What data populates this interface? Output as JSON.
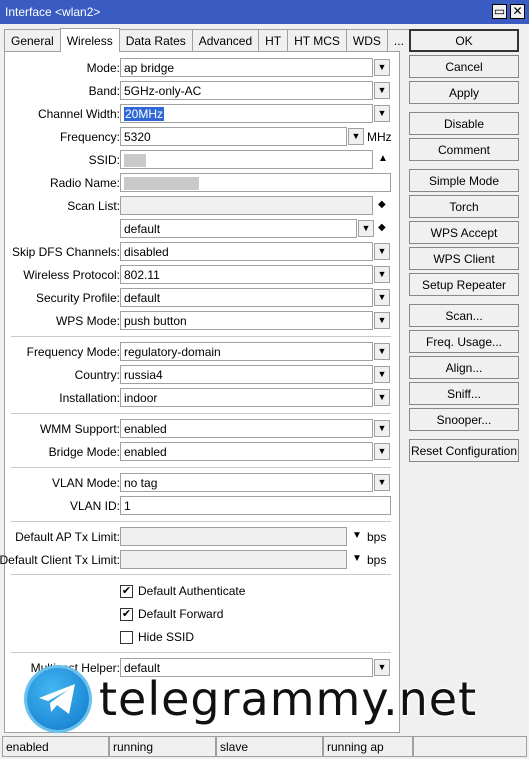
{
  "window": {
    "title": "Interface <wlan2>",
    "restore_glyph": "▭",
    "close_glyph": "✕"
  },
  "tabs": [
    "General",
    "Wireless",
    "Data Rates",
    "Advanced",
    "HT",
    "HT MCS",
    "WDS",
    "..."
  ],
  "active_tab": "Wireless",
  "form": {
    "mode": {
      "label": "Mode:",
      "value": "ap bridge"
    },
    "band": {
      "label": "Band:",
      "value": "5GHz-only-AC"
    },
    "channel_width": {
      "label": "Channel Width:",
      "value": "20MHz"
    },
    "frequency": {
      "label": "Frequency:",
      "value": "5320",
      "unit": "MHz"
    },
    "ssid": {
      "label": "SSID:"
    },
    "radio_name": {
      "label": "Radio Name:"
    },
    "scan_list": {
      "label": "Scan List:",
      "value": "",
      "value2": "default"
    },
    "skip_dfs": {
      "label": "Skip DFS Channels:",
      "value": "disabled"
    },
    "wireless_protocol": {
      "label": "Wireless Protocol:",
      "value": "802.11"
    },
    "security_profile": {
      "label": "Security Profile:",
      "value": "default"
    },
    "wps_mode": {
      "label": "WPS Mode:",
      "value": "push button"
    },
    "frequency_mode": {
      "label": "Frequency Mode:",
      "value": "regulatory-domain"
    },
    "country": {
      "label": "Country:",
      "value": "russia4"
    },
    "installation": {
      "label": "Installation:",
      "value": "indoor"
    },
    "wmm_support": {
      "label": "WMM Support:",
      "value": "enabled"
    },
    "bridge_mode": {
      "label": "Bridge Mode:",
      "value": "enabled"
    },
    "vlan_mode": {
      "label": "VLAN Mode:",
      "value": "no tag"
    },
    "vlan_id": {
      "label": "VLAN ID:",
      "value": "1"
    },
    "default_ap_tx": {
      "label": "Default AP Tx Limit:",
      "unit": "bps"
    },
    "default_client_tx": {
      "label": "Default Client Tx Limit:",
      "unit": "bps"
    },
    "default_authenticate": {
      "label": "Default Authenticate",
      "checked": true
    },
    "default_forward": {
      "label": "Default Forward",
      "checked": true
    },
    "hide_ssid": {
      "label": "Hide SSID",
      "checked": false
    },
    "multicast_helper": {
      "label": "Multicast Helper:",
      "value": "default"
    }
  },
  "buttons": {
    "ok": "OK",
    "cancel": "Cancel",
    "apply": "Apply",
    "disable": "Disable",
    "comment": "Comment",
    "simple_mode": "Simple Mode",
    "torch": "Torch",
    "wps_accept": "WPS Accept",
    "wps_client": "WPS Client",
    "setup_repeater": "Setup Repeater",
    "scan": "Scan...",
    "freq_usage": "Freq. Usage...",
    "align": "Align...",
    "sniff": "Sniff...",
    "snooper": "Snooper...",
    "reset_configuration": "Reset Configuration"
  },
  "status_bar": [
    "enabled",
    "running",
    "slave",
    "running ap",
    ""
  ],
  "watermark": {
    "text": "telegrammy.net"
  },
  "glyphs": {
    "dropdown": "▼",
    "up": "▲",
    "updown": "◆",
    "check": "✔"
  },
  "colors": {
    "titlebar": "#3a5cc2",
    "selection": "#2f68d6"
  }
}
